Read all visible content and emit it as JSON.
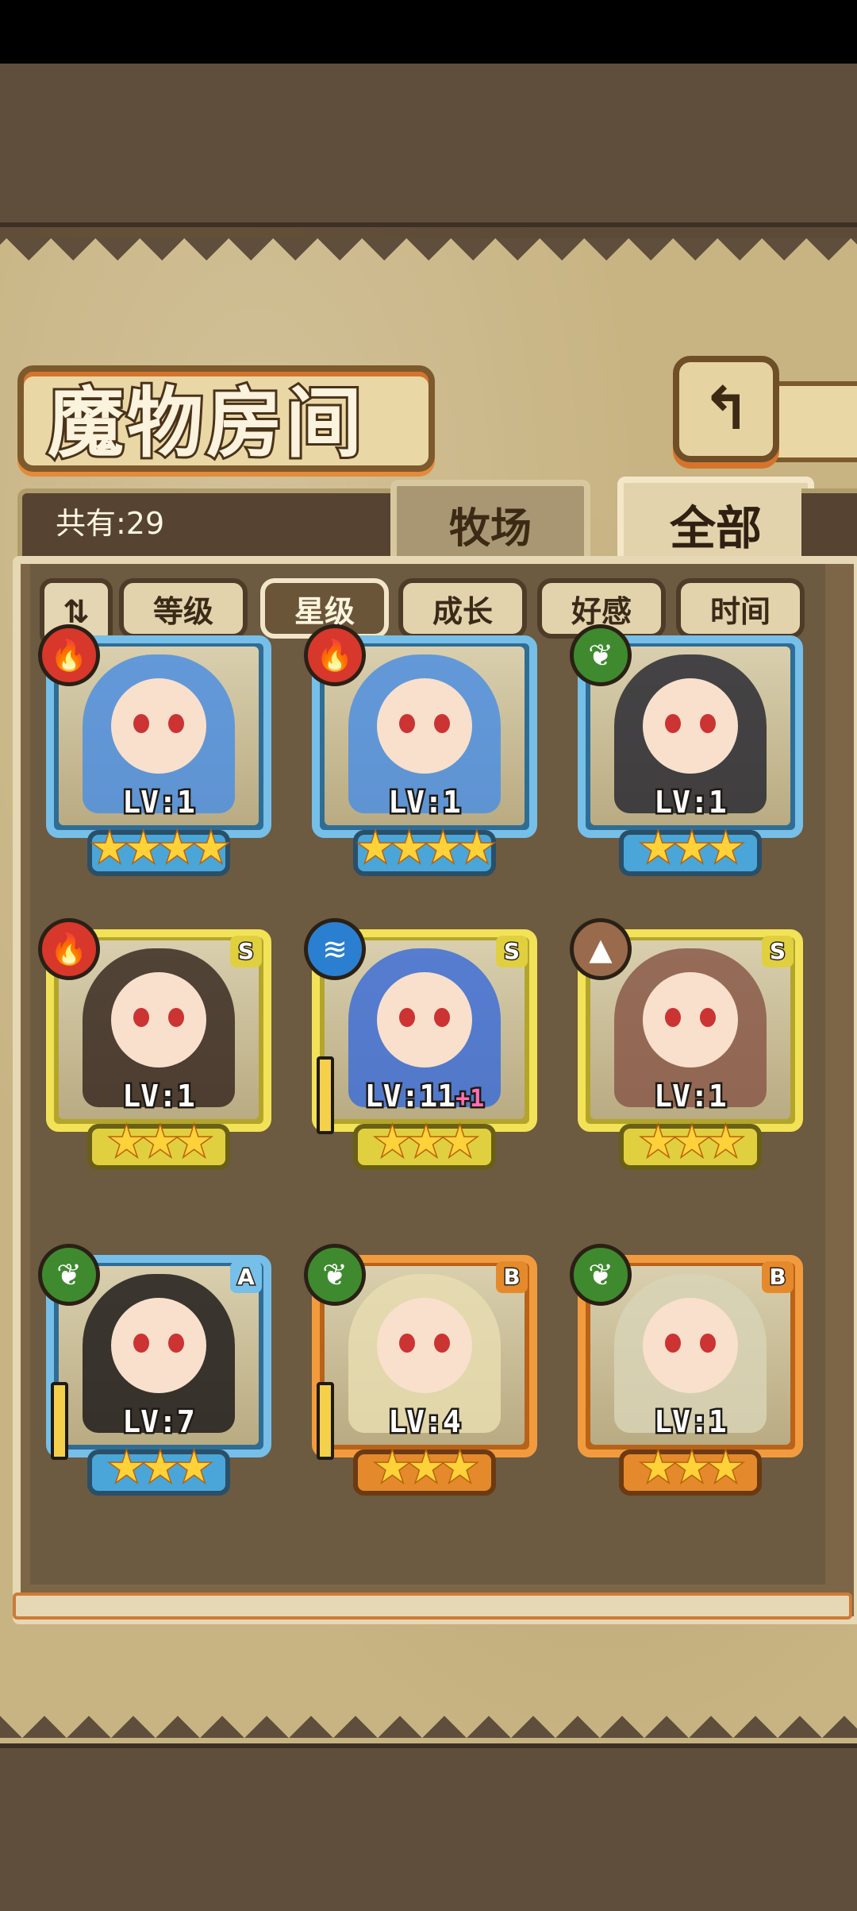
{
  "page": {
    "title": "魔物房间",
    "count_label": "共有:29"
  },
  "tabs": [
    {
      "label": "牧场",
      "active": false
    },
    {
      "label": "全部",
      "active": true
    }
  ],
  "sort": {
    "toggle_icon": "sort-order-icon",
    "buttons": [
      {
        "label": "等级",
        "active": false
      },
      {
        "label": "星级",
        "active": true
      },
      {
        "label": "成长",
        "active": false
      },
      {
        "label": "好感",
        "active": false
      },
      {
        "label": "时间",
        "active": false
      }
    ]
  },
  "colors": {
    "frame_blue": "#76bfe8",
    "frame_yellow": "#f2e257",
    "frame_orange": "#f19b3e",
    "star": "#ffd23a"
  },
  "monsters": [
    {
      "level": "LV:1",
      "plus": "",
      "stars": 4,
      "stars_text": "★★★★",
      "element": "fire",
      "element_icon": "fire-icon",
      "grade": "",
      "rarity": "blue",
      "weapon": false,
      "hair": "#4f8fe0"
    },
    {
      "level": "LV:1",
      "plus": "",
      "stars": 4,
      "stars_text": "★★★★",
      "element": "fire",
      "element_icon": "fire-icon",
      "grade": "",
      "rarity": "blue",
      "weapon": false,
      "hair": "#4f8fe0"
    },
    {
      "level": "LV:1",
      "plus": "",
      "stars": 3,
      "stars_text": "★★★",
      "element": "wood",
      "element_icon": "leaf-icon",
      "grade": "",
      "rarity": "blue",
      "weapon": false,
      "hair": "#2a2a32"
    },
    {
      "level": "LV:1",
      "plus": "",
      "stars": 3,
      "stars_text": "★★★",
      "element": "fire",
      "element_icon": "fire-icon",
      "grade": "S",
      "rarity": "yellow",
      "weapon": false,
      "hair": "#3a2a22"
    },
    {
      "level": "LV:11",
      "plus": "+1",
      "stars": 3,
      "stars_text": "★★★",
      "element": "water",
      "element_icon": "water-icon",
      "grade": "S",
      "rarity": "yellow",
      "weapon": true,
      "hair": "#3f6fd6"
    },
    {
      "level": "LV:1",
      "plus": "",
      "stars": 3,
      "stars_text": "★★★",
      "element": "earth",
      "element_icon": "mountain-icon",
      "grade": "S",
      "rarity": "yellow",
      "weapon": false,
      "hair": "#8a5a4a"
    },
    {
      "level": "LV:7",
      "plus": "",
      "stars": 3,
      "stars_text": "★★★",
      "element": "wood",
      "element_icon": "leaf-icon",
      "grade": "A",
      "rarity": "blue",
      "weapon": true,
      "hair": "#1f1b1a"
    },
    {
      "level": "LV:4",
      "plus": "",
      "stars": 3,
      "stars_text": "★★★",
      "element": "wood",
      "element_icon": "leaf-icon",
      "grade": "B",
      "rarity": "orange",
      "weapon": true,
      "hair": "#e8dcb0"
    },
    {
      "level": "LV:1",
      "plus": "",
      "stars": 3,
      "stars_text": "★★★",
      "element": "wood",
      "element_icon": "leaf-icon",
      "grade": "B",
      "rarity": "orange",
      "weapon": false,
      "hair": "#d8d3b6"
    }
  ]
}
